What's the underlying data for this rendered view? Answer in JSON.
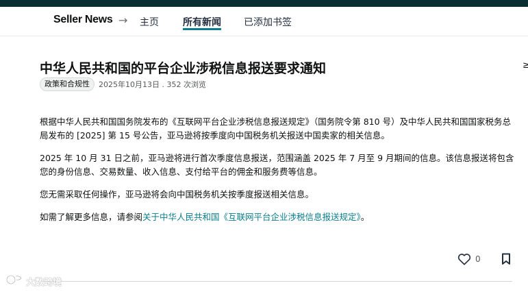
{
  "nav": {
    "brand": "Seller News",
    "arrow": "→",
    "tabs": [
      "主页",
      "所有新闻",
      "已添加书签"
    ],
    "active_tab": "所有新闻",
    "accent_color": "#0a7e8c",
    "topbar_color": "#0b2e33"
  },
  "article": {
    "title": "中华人民共和国的平台企业涉税信息报送要求通知",
    "category": "政策和合规性",
    "meta": "2025年10月13日 . 352 次浏览",
    "paragraphs": [
      "根据中华人民共和国国务院发布的《互联网平台企业涉税信息报送规定》（国务院令第 810 号）及中华人民共和国国家税务总局发布的 [2025] 第 15 号公告，亚马逊将按季度向中国税务机关报送中国卖家的相关信息。",
      "2025 年 10 月 31 日之前，亚马逊将进行首次季度信息报送，范围涵盖 2025 年 7 月至 9 月期间的信息。该信息报送将包含您的身份信息、交易数量、收入信息、支付给平台的佣金和服务费等信息。",
      "您无需采取任何操作，亚马逊将会向中国税务机关按季度报送相关信息。"
    ],
    "last_paragraph_prefix": "如需了解更多信息，请参阅",
    "last_paragraph_link": "关于中华人民共和国《互联网平台企业涉税信息报送规定》",
    "last_paragraph_suffix": "。"
  },
  "actions": {
    "like_icon": "heart-outline-icon",
    "like_count": "0",
    "bookmark_icon": "bookmark-outline-icon"
  },
  "edge": {
    "right_glyph": "≥"
  },
  "watermark": {
    "text": "大数跨境",
    "logo_icon": "watermark-logo-icon"
  }
}
